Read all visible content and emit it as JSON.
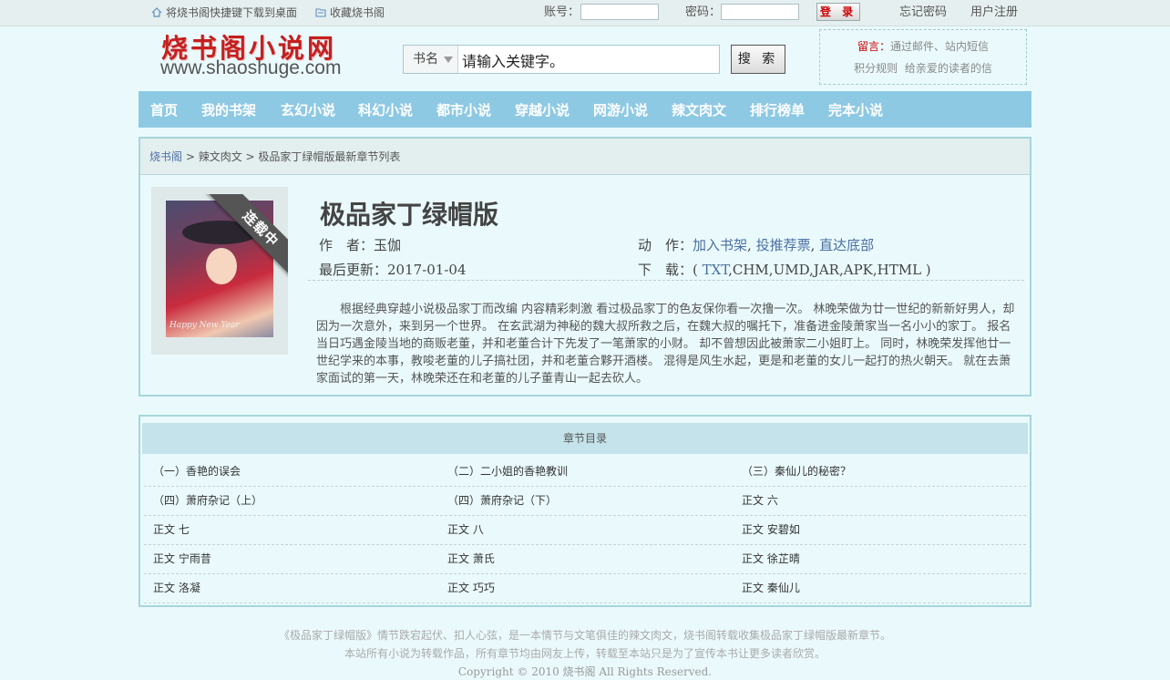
{
  "topbar": {
    "shortcut_label": "将烧书阁快捷键下载到桌面",
    "favorite_label": "收藏烧书阁",
    "account_label": "账号：",
    "password_label": "密码：",
    "login_label": "登 录",
    "forgot_label": "忘记密码",
    "register_label": "用户注册"
  },
  "header": {
    "logo_cn": "烧书阁小说网",
    "logo_en": "www.shaoshuge.com",
    "search_type": "书名",
    "search_value": "请输入关键字。",
    "search_button": "搜 索",
    "message_label": "留言：",
    "message_text": "通过邮件、站内短信",
    "rules_label": "积分规则",
    "rules_text": "给亲爱的读者的信"
  },
  "nav": [
    "首页",
    "我的书架",
    "玄幻小说",
    "科幻小说",
    "都市小说",
    "穿越小说",
    "网游小说",
    "辣文肉文",
    "排行榜单",
    "完本小说"
  ],
  "breadcrumb": {
    "home": "烧书阁",
    "sep1": " > ",
    "category": "辣文肉文",
    "sep2": " > ",
    "current": "极品家丁绿帽版最新章节列表"
  },
  "book": {
    "title": "极品家丁绿帽版",
    "status_ribbon": "连载中",
    "cover_caption": "Happy New Year",
    "author_label": "作　者：",
    "author": "玉伽",
    "updated_label": "最后更新：",
    "updated": "2017-01-04",
    "action_label": "动　作：",
    "action_shelf": "加入书架",
    "action_vote": "投推荐票",
    "action_bottom": "直达底部",
    "comma": ",",
    "download_label": "下　载：( ",
    "download_txt": "TXT",
    "download_rest": ",CHM,UMD,JAR,APK,HTML )",
    "description": "根据经典穿越小说极品家丁而改编 内容精彩刺激 看过极品家丁的色友保你看一次撸一次。 林晚荣做为廿一世纪的新新好男人，却因为一次意外，来到另一个世界。 在玄武湖为神秘的魏大叔所救之后，在魏大叔的嘱托下，准备进金陵萧家当一名小小的家丁。 报名当日巧遇金陵当地的商贩老董，并和老董合计下先发了一笔萧家的小财。 却不曾想因此被萧家二小姐盯上。 同时，林晚荣发挥他廿一世纪学来的本事，教唆老董的儿子搞社团，并和老董合夥开酒楼。 混得是风生水起，更是和老董的女儿一起打的热火朝天。 就在去萧家面试的第一天，林晚荣还在和老董的儿子董青山一起去砍人。"
  },
  "chapters": {
    "heading": "章节目录",
    "rows": [
      [
        "（一）香艳的误会",
        "（二）二小姐的香艳教训",
        "（三）秦仙儿的秘密？"
      ],
      [
        "（四）萧府杂记（上）",
        "（四）萧府杂记（下）",
        "正文 六"
      ],
      [
        "正文 七",
        "正文 八",
        "正文 安碧如"
      ],
      [
        "正文 宁雨昔",
        "正文 萧氏",
        "正文 徐芷晴"
      ],
      [
        "正文 洛凝",
        "正文 巧巧",
        "正文 秦仙儿"
      ]
    ]
  },
  "footer": {
    "line1": "《极品家丁绿帽版》情节跌宕起伏、扣人心弦，是一本情节与文笔俱佳的辣文肉文，烧书阁转载收集极品家丁绿帽版最新章节。",
    "line2": "本站所有小说为转载作品，所有章节均由网友上传，转载至本站只是为了宣传本书让更多读者欣赏。",
    "line3": "Copyright © 2010 烧书阁 All Rights Reserved."
  }
}
